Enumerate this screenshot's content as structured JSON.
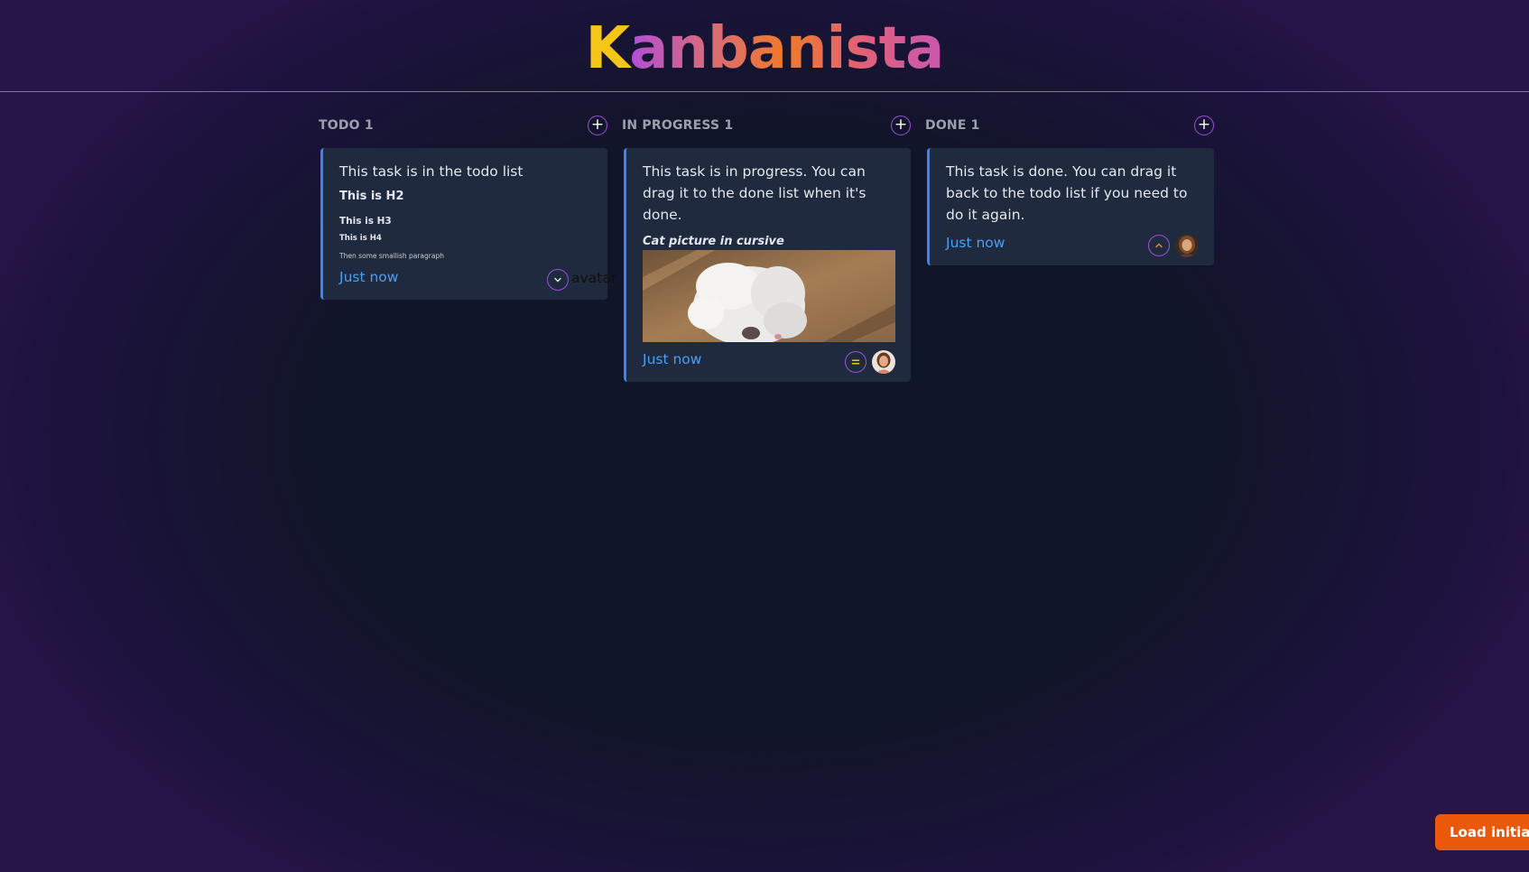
{
  "header": {
    "logo_first": "K",
    "logo_rest": "anbanista"
  },
  "columns": [
    {
      "title": "TODO 1",
      "add_icon": "+",
      "card": {
        "text": "This task is in the todo list",
        "h2": "This is H2",
        "h3": "This is H3",
        "h4": "This is H4",
        "paragraph": "Then some smallish paragraph",
        "time": "Just now",
        "priority_icon": "chevron-down-icon",
        "avatar_alt": "avatar"
      }
    },
    {
      "title": "IN PROGRESS 1",
      "add_icon": "+",
      "card": {
        "text": "This task is in progress. You can drag it to the done list when it's done.",
        "caption": "Cat picture in cursive",
        "time": "Just now",
        "priority_icon": "equals-icon"
      }
    },
    {
      "title": "DONE 1",
      "add_icon": "+",
      "card": {
        "text": "This task is done. You can drag it back to the todo list if you need to do it again.",
        "time": "Just now",
        "priority_icon": "chevron-up-icon"
      }
    }
  ],
  "load_button": {
    "label": "Load initial"
  },
  "colors": {
    "accent_blue": "#3b82f6",
    "accent_purple": "#9b4fd8",
    "accent_orange": "#ea580c",
    "logo_yellow": "#f5c518"
  }
}
